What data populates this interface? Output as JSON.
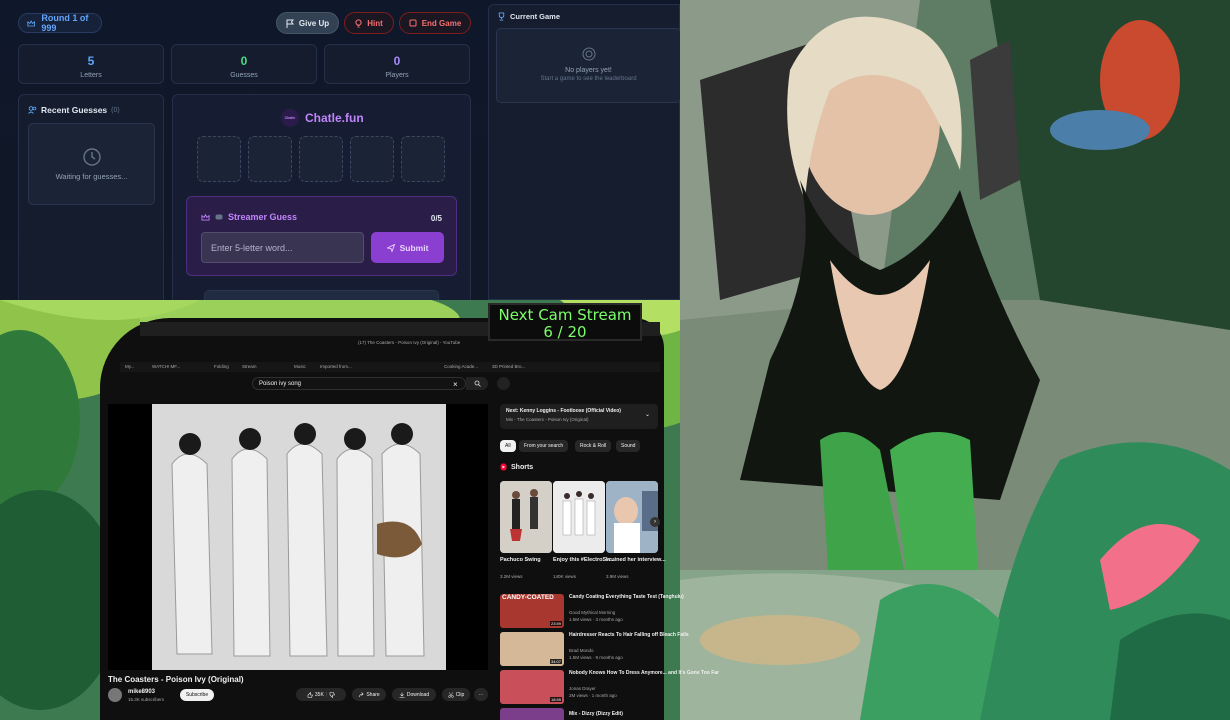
{
  "game": {
    "round_label": "Round 1 of 999",
    "buttons": {
      "give_up": "Give Up",
      "hint": "Hint",
      "end_game": "End Game"
    },
    "stats": [
      {
        "value": "5",
        "label": "Letters"
      },
      {
        "value": "0",
        "label": "Guesses"
      },
      {
        "value": "0",
        "label": "Players"
      }
    ],
    "recent_guesses": {
      "title": "Recent Guesses",
      "count": "(0)",
      "empty": "Waiting for guesses..."
    },
    "brand": "Chatle.fun",
    "brand_logo_text": "Chatle",
    "streamer_guess": {
      "title": "Streamer Guess",
      "counter": "0/5",
      "placeholder": "Enter 5-letter word...",
      "submit": "Submit"
    },
    "current_game": {
      "title": "Current Game",
      "empty_title": "No players yet!",
      "empty_sub": "Start a game to see the leaderboard"
    },
    "colors": {
      "accent_blue": "#60a5fa",
      "accent_purple": "#a855f7",
      "accent_red": "#f87171",
      "bg": "#0f172a"
    }
  },
  "counter": {
    "title": "Next Cam Stream",
    "value": "6 / 20"
  },
  "browser": {
    "tab_title": "(17) The Coasters - Poison Ivy (Original) - YouTube",
    "bookmarks": [
      "My...",
      "WATCH! MF...",
      "Folding",
      "Stream",
      "Music",
      "Imported from...",
      "Cooking Acade...",
      "3D Printed Bro..."
    ],
    "search_query": "Poison ivy song",
    "video": {
      "title": "The Coasters - Poison Ivy (Original)",
      "channel": "mike8903",
      "subscribers": "15.3K subscribers",
      "subscribe": "Subscribe"
    },
    "actions": {
      "likes": "35K",
      "share": "Share",
      "download": "Download",
      "clip": "Clip"
    },
    "next_up": {
      "title": "Next: Kenny Loggins - Footloose (Official Video)",
      "subtitle": "Mix - The Coasters - Poison Ivy (Original)"
    },
    "chips": [
      "All",
      "From your search",
      "Rock & Roll",
      "Sound"
    ],
    "shorts_heading": "Shorts",
    "shorts": [
      {
        "title": "Pachuco Swing",
        "views": "3.2M views"
      },
      {
        "title": "Enjoy this #ElectroSw...",
        "views": "140K views"
      },
      {
        "title": "I ruined her interview...",
        "views": "3.9M views"
      }
    ],
    "videos": [
      {
        "title": "Candy Coating Everything Taste Test (Tanghulu)",
        "channel": "Good Mythical Morning",
        "meta": "1.5M views · 3 months ago",
        "duration": "23:59",
        "overlay": "CANDY-COATED"
      },
      {
        "title": "Hairdresser Reacts To Hair Falling off Bleach Fails",
        "channel": "Brad Mondo",
        "meta": "1.5M views · 9 months ago",
        "duration": "34:07",
        "overlay": ""
      },
      {
        "title": "Nobody Knows How To Dress Anymore... and It's Gone Too Far",
        "channel": "Jonas Drayer",
        "meta": "2M views · 1 month ago",
        "duration": "18:59",
        "overlay": ""
      },
      {
        "title": "Mix - Dizzy (Dizzy Edit)",
        "channel": "",
        "meta": "",
        "duration": "",
        "overlay": ""
      }
    ]
  }
}
